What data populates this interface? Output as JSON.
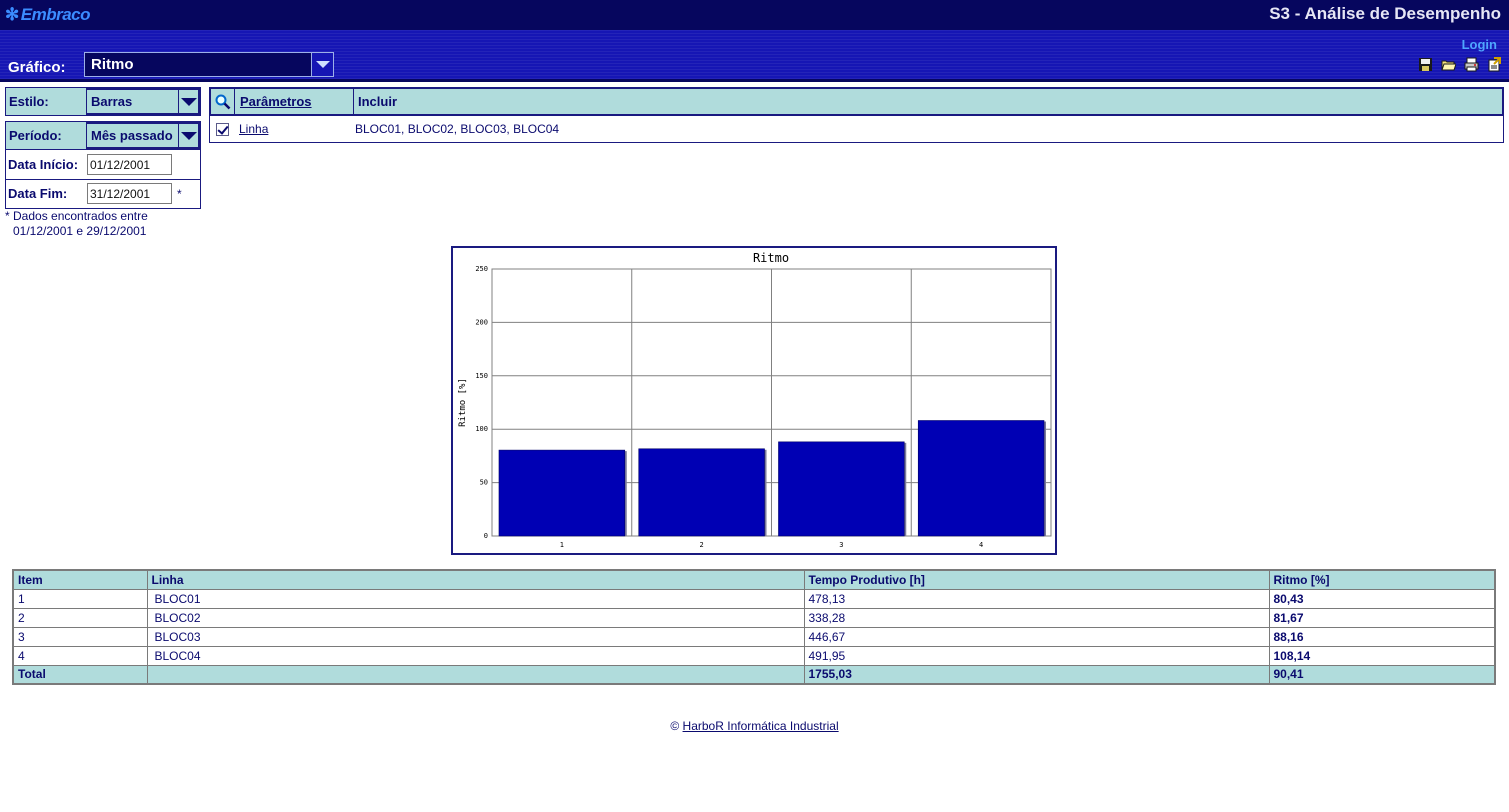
{
  "header": {
    "logo_text": "Embraco",
    "app_title": "S3 - Análise de Desempenho",
    "login_label": "Login"
  },
  "grafico": {
    "label": "Gráfico:",
    "selected": "Ritmo"
  },
  "toolbar": {
    "icons": [
      "save-icon",
      "open-folder-icon",
      "print-icon",
      "export-icon"
    ]
  },
  "filters": {
    "estilo_label": "Estilo:",
    "estilo_value": "Barras",
    "periodo_label": "Período:",
    "periodo_value": "Mês passado",
    "data_inicio_label": "Data Início:",
    "data_inicio_value": "01/12/2001",
    "data_fim_label": "Data Fim:",
    "data_fim_value": "31/12/2001",
    "data_fim_marker": "*",
    "note_line1": "* Dados encontrados entre",
    "note_line2": "01/12/2001 e 29/12/2001"
  },
  "params": {
    "col_parametros": "Parâmetros",
    "col_incluir": "Incluir",
    "rows": [
      {
        "name": "Linha",
        "checked": true,
        "value": "BLOC01, BLOC02, BLOC03, BLOC04"
      }
    ]
  },
  "chart_data": {
    "type": "bar",
    "title": "Ritmo",
    "xlabel": "",
    "ylabel": "Ritmo [%]",
    "categories": [
      "1",
      "2",
      "3",
      "4"
    ],
    "values": [
      80.43,
      81.67,
      88.16,
      108.14
    ],
    "ylim": [
      0,
      250
    ],
    "yticks": [
      0,
      50,
      100,
      150,
      200,
      250
    ],
    "grid": true,
    "bar_color": "#0000b4"
  },
  "table": {
    "headers": [
      "Item",
      "Linha",
      "Tempo Produtivo [h]",
      "Ritmo [%]"
    ],
    "rows": [
      [
        "1",
        "BLOC01",
        "478,13",
        "80,43"
      ],
      [
        "2",
        "BLOC02",
        "338,28",
        "81,67"
      ],
      [
        "3",
        "BLOC03",
        "446,67",
        "88,16"
      ],
      [
        "4",
        "BLOC04",
        "491,95",
        "108,14"
      ]
    ],
    "total": [
      "Total",
      "",
      "1755,03",
      "90,41"
    ]
  },
  "footer": {
    "copyright": "©",
    "link_text": "HarboR Informática Industrial"
  },
  "colors": {
    "header_dark": "#06065e",
    "header_blue": "#1616b4",
    "panel_teal": "#b0dcdc",
    "text_navy": "#0a0a6e"
  }
}
